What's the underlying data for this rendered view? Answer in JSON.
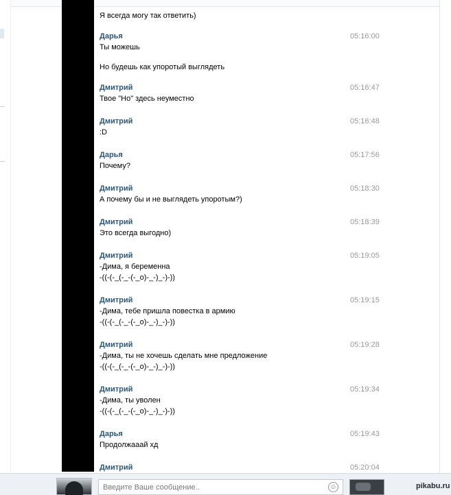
{
  "messages": [
    {
      "author": "",
      "time": "",
      "lines": [
        "Я всегда могу так ответить)"
      ]
    },
    {
      "author": "Дарья",
      "time": "05:16:00",
      "lines": [
        "Ты можешь"
      ]
    },
    {
      "author": "",
      "time": "",
      "lines": [
        "Но будешь как упоротый выглядеть"
      ]
    },
    {
      "author": "Дмитрий",
      "time": "05:16:47",
      "lines": [
        "Твое \"Но\" здесь неуместно"
      ]
    },
    {
      "author": "Дмитрий",
      "time": "05:16:48",
      "lines": [
        ":D"
      ]
    },
    {
      "author": "Дарья",
      "time": "05:17:56",
      "lines": [
        "Почему?"
      ]
    },
    {
      "author": "Дмитрий",
      "time": "05:18:30",
      "lines": [
        "А почему бы и не выглядеть упоротым?)"
      ]
    },
    {
      "author": "Дмитрий",
      "time": "05:18:39",
      "lines": [
        "Это всегда выгодно)"
      ]
    },
    {
      "author": "Дмитрий",
      "time": "05:19:05",
      "lines": [
        "-Дима, я беременна",
        "-((-(-_(-_-(-_o)-_-)_-)-))"
      ]
    },
    {
      "author": "Дмитрий",
      "time": "05:19:15",
      "lines": [
        "-Дима, тебе пришла повестка в армию",
        "-((-(-_(-_-(-_o)-_-)_-)-))"
      ]
    },
    {
      "author": "Дмитрий",
      "time": "05:19:28",
      "lines": [
        "-Дима, ты не хочешь сделать мне предложение",
        "-((-(-_(-_-(-_o)-_-)_-)-))"
      ]
    },
    {
      "author": "Дмитрий",
      "time": "05:19:34",
      "lines": [
        "-Дима, ты уволен",
        "-((-(-_(-_-(-_o)-_-)_-)-))"
      ]
    },
    {
      "author": "Дарья",
      "time": "05:19:43",
      "lines": [
        "Продолжааай хд"
      ]
    },
    {
      "author": "Дмитрий",
      "time": "05:20:04",
      "lines": []
    }
  ],
  "composer": {
    "placeholder": "Введите Ваше сообщение..",
    "emoji_icon": "smile-icon",
    "avatar_icon": "user-avatar",
    "attachment_icon": "photo-thumbnail"
  },
  "watermark": "pikabu.ru"
}
